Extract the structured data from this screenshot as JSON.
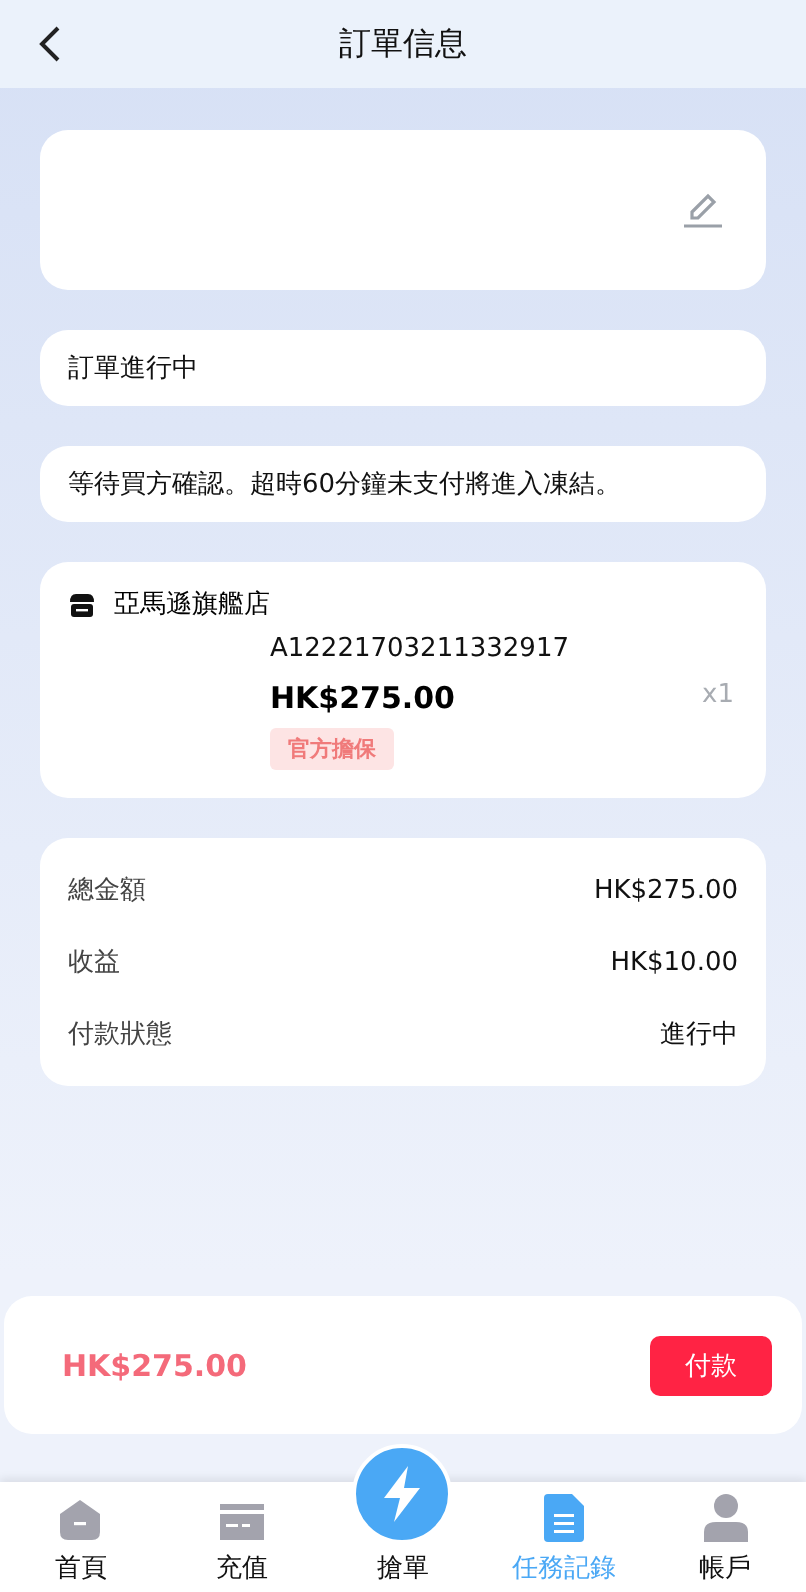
{
  "header": {
    "title": "訂單信息"
  },
  "status": "訂單進行中",
  "notice": "等待買方確認。超時60分鐘未支付將進入凍結。",
  "shop": {
    "name": "亞馬遜旗艦店",
    "order_no": "A12221703211332917",
    "price": "HK$275.00",
    "quantity": "x1",
    "tag": "官方擔保"
  },
  "summary": [
    {
      "label": "總金額",
      "value": "HK$275.00"
    },
    {
      "label": "收益",
      "value": "HK$10.00"
    },
    {
      "label": "付款狀態",
      "value": "進行中"
    }
  ],
  "footer": {
    "total": "HK$275.00",
    "pay_button": "付款"
  },
  "nav": [
    {
      "label": "首頁",
      "kind": "home",
      "selected": false
    },
    {
      "label": "充值",
      "kind": "card",
      "selected": false
    },
    {
      "label": "搶單",
      "kind": "center",
      "selected": false
    },
    {
      "label": "任務記錄",
      "kind": "doc",
      "selected": true
    },
    {
      "label": "帳戶",
      "kind": "user",
      "selected": false
    }
  ]
}
